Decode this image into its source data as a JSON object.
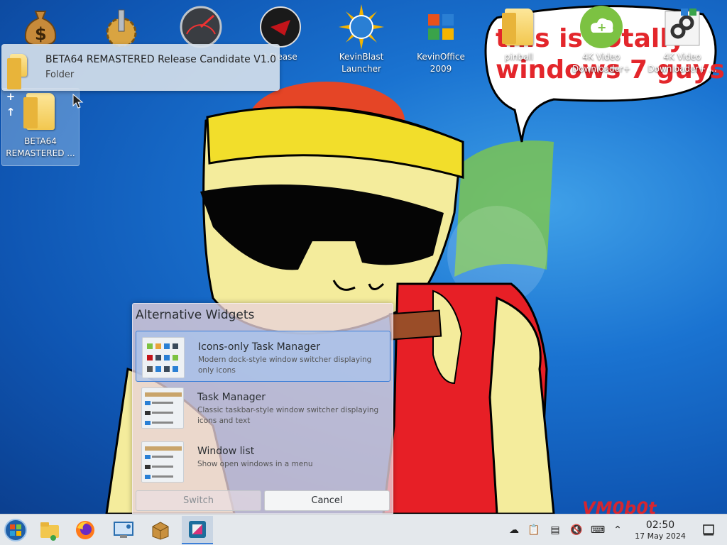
{
  "desktop": {
    "wallpaper_caption_line1": "this is totally",
    "wallpaper_caption_line2": "windows 7 guys",
    "wallpaper_signature": "VM0b0t",
    "icons": [
      {
        "label": "",
        "icon": "money-bag-icon"
      },
      {
        "label": "",
        "icon": "gear-icon"
      },
      {
        "label": "",
        "icon": "speedometer-icon"
      },
      {
        "label": "t Please",
        "icon": "red-orb-icon"
      },
      {
        "label": "KevinBlast\nLauncher",
        "icon": "sun-globe-icon"
      },
      {
        "label": "KevinOffice\n2009",
        "icon": "office-icon"
      },
      {
        "label": "pinball",
        "icon": "folder-icon"
      },
      {
        "label": "4K Video\nDownloader+",
        "icon": "download-cloud-icon"
      },
      {
        "label": "4K Video\nDownloader+ ...",
        "icon": "shortcut-link-icon"
      },
      {
        "label": "BETA64\nREMASTERED ...",
        "icon": "folder-icon"
      }
    ]
  },
  "tooltip": {
    "title": "BETA64 REMASTERED Release Candidate V1.0",
    "subtitle": "Folder"
  },
  "alt_widgets": {
    "title": "Alternative Widgets",
    "items": [
      {
        "name": "Icons-only Task Manager",
        "description": "Modern dock-style window switcher displaying only icons",
        "selected": true
      },
      {
        "name": "Task Manager",
        "description": "Classic taskbar-style window switcher displaying icons and text",
        "selected": false
      },
      {
        "name": "Window list",
        "description": "Show open windows in a menu",
        "selected": false
      }
    ],
    "switch_label": "Switch",
    "cancel_label": "Cancel"
  },
  "taskbar": {
    "apps": [
      "start-orb-icon",
      "file-manager-icon",
      "firefox-icon",
      "control-panel-icon",
      "archive-box-icon",
      "kde-store-icon"
    ],
    "active_app_index": 5,
    "tray": [
      "cloud-download-icon",
      "clipboard-icon",
      "notes-icon",
      "volume-muted-icon",
      "keyboard-layout-icon",
      "chevron-up-icon"
    ],
    "clock_time": "02:50",
    "clock_date": "17 May 2024"
  },
  "colors": {
    "accent": "#3d7fd8",
    "caption_red": "#e3262b",
    "taskbar_bg": "#e4e8ec"
  }
}
